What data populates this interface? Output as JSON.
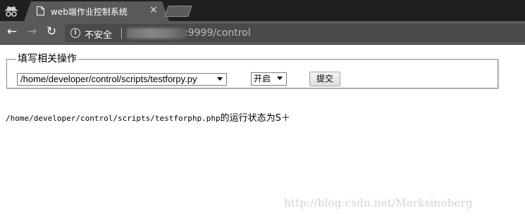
{
  "tab": {
    "title": "web端作业控制系统",
    "close_glyph": "×",
    "favicon": "page-icon"
  },
  "toolbar": {
    "back_glyph": "←",
    "forward_glyph": "→",
    "reload_glyph": "↻",
    "info_glyph": "i",
    "security_text": "不安全",
    "url_visible": ":9999/control"
  },
  "form": {
    "legend": "填写相关操作",
    "script_select": {
      "selected": "/home/developer/control/scripts/testforpy.py"
    },
    "state_select": {
      "selected": "开启"
    },
    "submit_label": "提交"
  },
  "status": {
    "path": "/home/developer/control/scripts/testforphp.php",
    "message": "的运行状态为S＋"
  },
  "watermark": "http://blog.csdn.net/Marksinoberg",
  "colors": {
    "tabstrip": "#1f1f1f",
    "toolbar": "#595959",
    "omnibox": "#4a4a4a",
    "fieldset_border": "#8b8b8b"
  }
}
